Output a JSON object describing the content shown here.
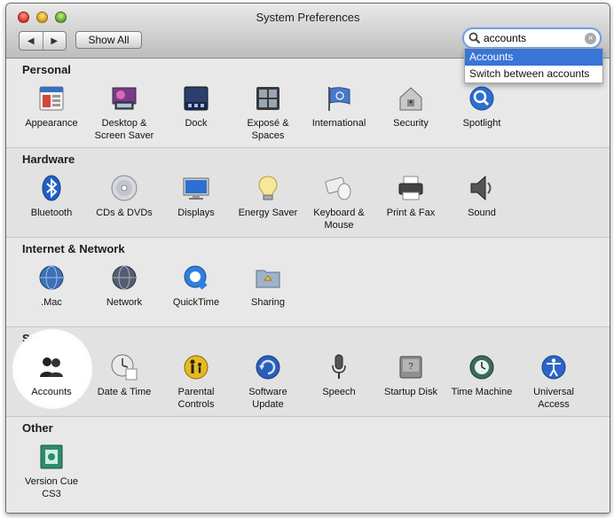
{
  "window": {
    "title": "System Preferences"
  },
  "toolbar": {
    "back_label": "◀",
    "forward_label": "▶",
    "show_all_label": "Show All"
  },
  "search": {
    "value": "accounts",
    "clear_label": "×"
  },
  "dropdown": {
    "items": [
      "Accounts",
      "Switch between accounts"
    ]
  },
  "sections": [
    {
      "title": "Personal",
      "items": [
        {
          "label": "Appearance",
          "icon": "appearance-icon"
        },
        {
          "label": "Desktop & Screen Saver",
          "icon": "desktop-icon"
        },
        {
          "label": "Dock",
          "icon": "dock-icon"
        },
        {
          "label": "Exposé & Spaces",
          "icon": "expose-icon"
        },
        {
          "label": "International",
          "icon": "flag-icon"
        },
        {
          "label": "Security",
          "icon": "house-lock-icon"
        },
        {
          "label": "Spotlight",
          "icon": "magnifier-icon"
        }
      ]
    },
    {
      "title": "Hardware",
      "items": [
        {
          "label": "Bluetooth",
          "icon": "bluetooth-icon"
        },
        {
          "label": "CDs & DVDs",
          "icon": "disc-icon"
        },
        {
          "label": "Displays",
          "icon": "monitor-icon"
        },
        {
          "label": "Energy Saver",
          "icon": "bulb-icon"
        },
        {
          "label": "Keyboard & Mouse",
          "icon": "keyboard-mouse-icon"
        },
        {
          "label": "Print & Fax",
          "icon": "printer-icon"
        },
        {
          "label": "Sound",
          "icon": "speaker-icon"
        }
      ]
    },
    {
      "title": "Internet & Network",
      "items": [
        {
          "label": ".Mac",
          "icon": "globe-icon"
        },
        {
          "label": "Network",
          "icon": "network-globe-icon"
        },
        {
          "label": "QuickTime",
          "icon": "quicktime-icon"
        },
        {
          "label": "Sharing",
          "icon": "folder-sharing-icon"
        }
      ]
    },
    {
      "title": "System",
      "items": [
        {
          "label": "Accounts",
          "icon": "users-icon"
        },
        {
          "label": "Date & Time",
          "icon": "clock-icon"
        },
        {
          "label": "Parental Controls",
          "icon": "parental-icon"
        },
        {
          "label": "Software Update",
          "icon": "update-icon"
        },
        {
          "label": "Speech",
          "icon": "microphone-icon"
        },
        {
          "label": "Startup Disk",
          "icon": "harddisk-icon"
        },
        {
          "label": "Time Machine",
          "icon": "time-machine-icon"
        },
        {
          "label": "Universal Access",
          "icon": "universal-access-icon"
        }
      ]
    },
    {
      "title": "Other",
      "items": [
        {
          "label": "Version Cue CS3",
          "icon": "version-cue-icon"
        }
      ]
    }
  ]
}
